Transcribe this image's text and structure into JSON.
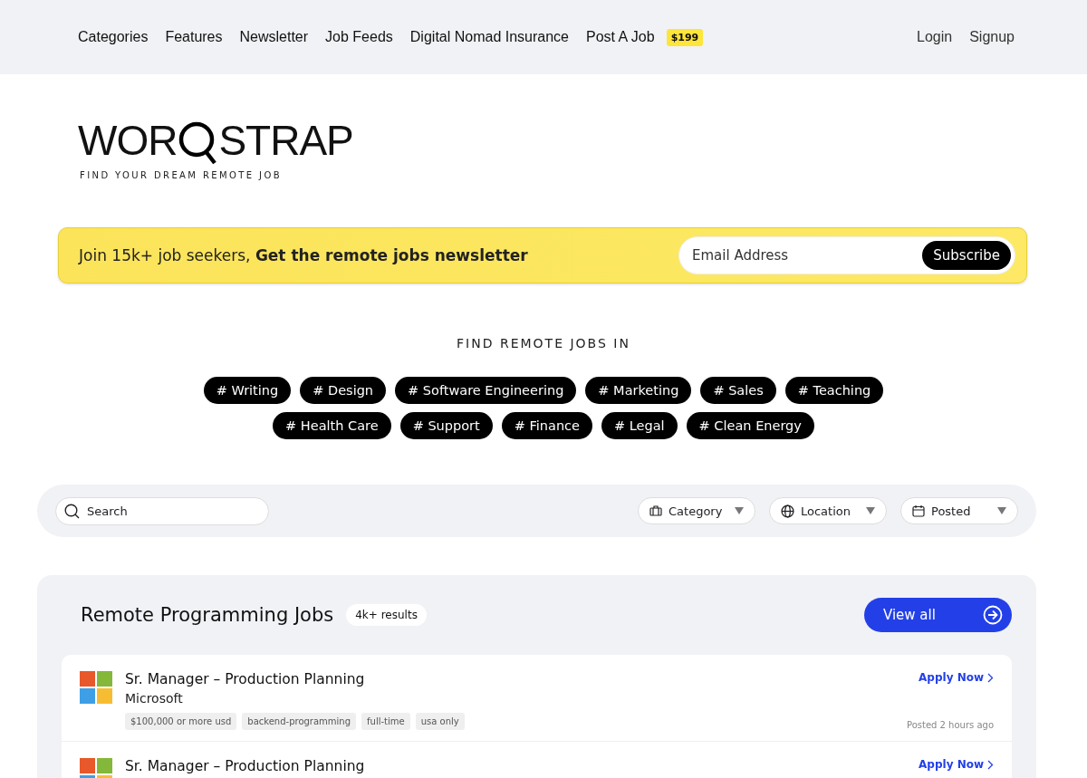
{
  "nav": {
    "links": [
      "Categories",
      "Features",
      "Newsletter",
      "Job Feeds",
      "Digital Nomad Insurance",
      "Post A Job"
    ],
    "price_badge": "$199",
    "account": [
      "Login",
      "Signup"
    ]
  },
  "logo": {
    "left": "WOR",
    "right": "STRAP",
    "tagline": "FIND YOUR DREAM REMOTE JOB"
  },
  "newsletter": {
    "lead": "Join 15k+ job seekers, **Get the remote jobs newsletter**",
    "placeholder": "Email Address",
    "button": "Subscribe"
  },
  "categories": {
    "title": "FIND REMOTE JOBS IN",
    "tags": [
      "# Writing",
      "# Design",
      "# Software Engineering",
      "# Marketing",
      "# Sales",
      "# Teaching",
      "# Health Care",
      "# Support",
      "# Finance",
      "# Legal",
      "# Clean Energy"
    ]
  },
  "filters": {
    "search_placeholder": "Search",
    "dropdowns": [
      {
        "kind": "category",
        "label": "Category"
      },
      {
        "kind": "location",
        "label": "Location"
      },
      {
        "kind": "posted",
        "label": "Posted"
      }
    ]
  },
  "jobs": {
    "title": "Remote Programming Jobs",
    "count": "4k+ results",
    "view_all": "View all",
    "rows": [
      {
        "title": "Sr. Manager – Production Planning",
        "company": "Microsoft",
        "tags": [
          "$100,000 or more usd",
          "backend-programming",
          "full-time",
          "usa only"
        ],
        "apply": "Apply Now",
        "posted": "Posted 2 hours ago"
      },
      {
        "title": "Sr. Manager – Production Planning",
        "apply": "Apply Now"
      }
    ]
  }
}
